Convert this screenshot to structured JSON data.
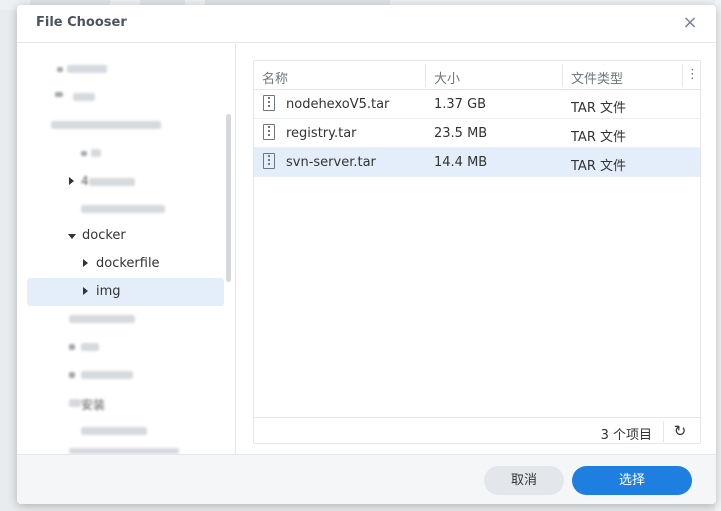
{
  "dialog": {
    "title": "File Chooser",
    "close_label": "×"
  },
  "tree": {
    "items": [
      {
        "label": "docker",
        "expanded": true
      },
      {
        "label": "dockerfile",
        "expanded": false
      },
      {
        "label": "img",
        "expanded": false,
        "selected": true
      }
    ],
    "partial_labels": [
      "4",
      "安装"
    ]
  },
  "file_list": {
    "columns": [
      "名称",
      "大小",
      "文件类型"
    ],
    "menu_icon": "⋮",
    "rows": [
      {
        "name": "nodehexoV5.tar",
        "size": "1.37 GB",
        "type": "TAR 文件",
        "icon": "zip-file-icon"
      },
      {
        "name": "registry.tar",
        "size": "23.5 MB",
        "type": "TAR 文件",
        "icon": "zip-file-icon"
      },
      {
        "name": "svn-server.tar",
        "size": "14.4 MB",
        "type": "TAR 文件",
        "icon": "zip-file-icon",
        "selected": true
      }
    ],
    "item_count": "3 个项目",
    "refresh_icon": "↻"
  },
  "footer": {
    "cancel_label": "取消",
    "ok_label": "选择"
  },
  "colors": {
    "accent": "#1e7fe0",
    "selection": "#e4eefa"
  }
}
